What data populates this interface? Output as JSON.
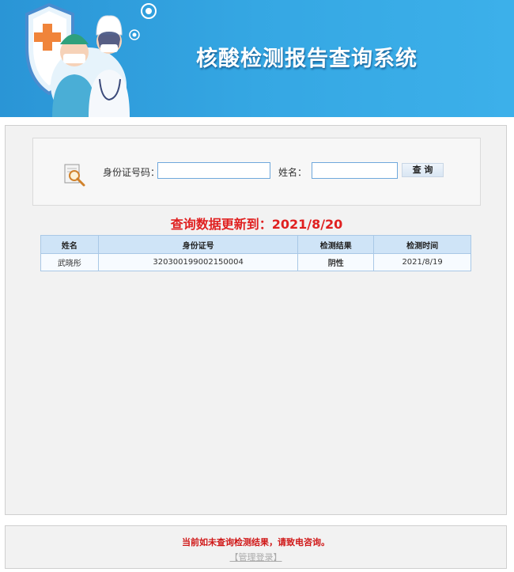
{
  "header": {
    "title": "核酸检测报告查询系统"
  },
  "search": {
    "id_label": "身份证号码：",
    "name_label": "姓名：",
    "id_value": "",
    "name_value": "",
    "button_label": "查 询"
  },
  "update_notice": "查询数据更新到：2021/8/20",
  "table": {
    "headers": [
      "姓名",
      "身份证号",
      "检测结果",
      "检测时间"
    ],
    "rows": [
      {
        "name": "武晓彤",
        "id_number": "320300199002150004",
        "result": "阴性",
        "test_date": "2021/8/19"
      }
    ]
  },
  "colors": {
    "banner": "#35a7e3",
    "alert_red": "#e02020",
    "negative_green": "#1a8a1a"
  },
  "footer": {
    "notice": "当前如未查询检测结果，请致电咨询。",
    "admin_login": "【管理登录】"
  }
}
